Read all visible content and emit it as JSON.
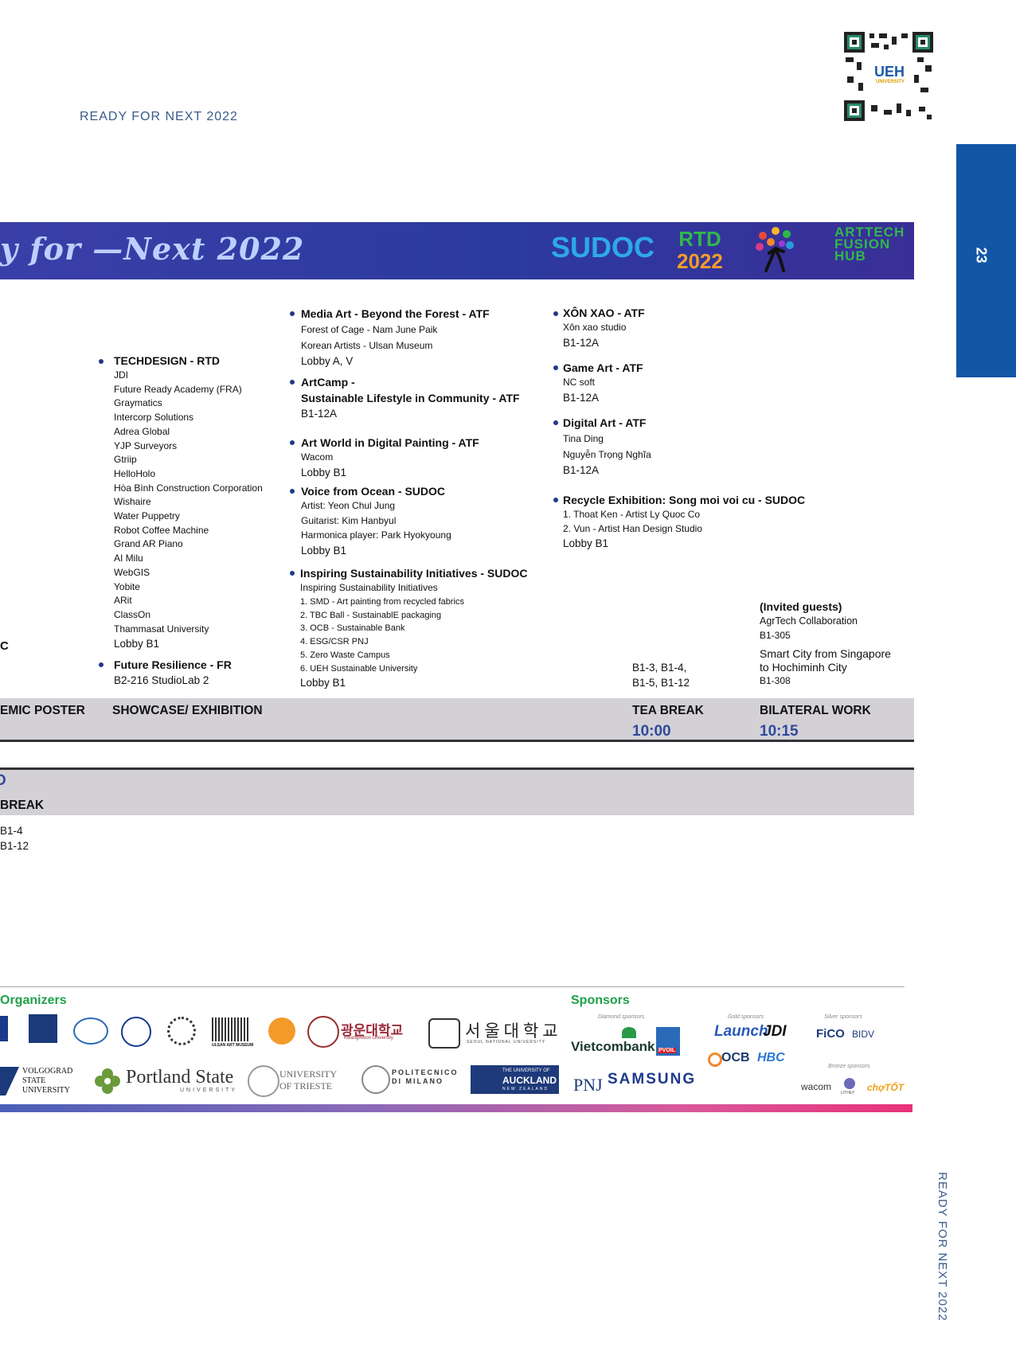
{
  "header": {
    "left_text": "READY FOR NEXT 2022"
  },
  "page": {
    "number": "23",
    "side_footer": "READY FOR NEXT 2022"
  },
  "qr": {
    "label": "UEH",
    "sublabel": "UNIVERSITY"
  },
  "banner": {
    "title": "y for —Next 2022",
    "logos": {
      "sudoc": "SUDOC",
      "rtd": "RTD",
      "rtd_year": "2022",
      "arttech": [
        "ARTTECH",
        "FUSION",
        "HUB"
      ]
    }
  },
  "col1": {
    "techdesign": {
      "title": "TECHDESIGN - RTD",
      "items": [
        "JDI",
        "Future Ready Academy (FRA)",
        "Graymatics",
        "Intercorp Solutions",
        "Adrea Global",
        "YJP Surveyors",
        "Gtriip",
        "HelloHolo",
        "Hòa Bình Construction Corporation",
        "Wishaire",
        "Water Puppetry",
        "Robot Coffee Machine",
        "Grand AR Piano",
        "AI Milu",
        "WebGIS",
        "Yobite",
        "ARit",
        "ClassOn",
        "Thammasat University"
      ],
      "location": "Lobby B1"
    },
    "future": {
      "title": "Future Resilience - FR",
      "location": "B2-216 StudioLab 2"
    }
  },
  "col2": {
    "media": {
      "title": "Media Art - Beyond the Forest - ATF",
      "items": [
        "Forest of Cage - Nam June Paik",
        "Korean Artists - Ulsan Museum"
      ],
      "location": "Lobby A, V"
    },
    "artcamp": {
      "title1": "ArtCamp -",
      "title2": "Sustainable Lifestyle in Community - ATF",
      "location": "B1-12A"
    },
    "artworld": {
      "title": "Art World in Digital Painting - ATF",
      "items": [
        "Wacom"
      ],
      "location": "Lobby B1"
    },
    "voice": {
      "title": "Voice from Ocean - SUDOC",
      "items": [
        "Artist: Yeon Chul Jung",
        "Guitarist: Kim Hanbyul",
        "Harmonica player: Park Hyokyoung"
      ],
      "location": "Lobby B1"
    },
    "inspiring": {
      "title": "Inspiring Sustainability Initiatives - SUDOC",
      "subtitle": "Inspiring Sustainability Initiatives",
      "items": [
        "1. SMD - Art painting from recycled fabrics",
        "2. TBC Ball - SustainablE packaging",
        "3. OCB - Sustainable Bank",
        "4. ESG/CSR PNJ",
        "5. Zero Waste Campus",
        "6. UEH Sustainable University"
      ],
      "location": "Lobby B1"
    }
  },
  "col3": {
    "xonxao": {
      "title": "XÔN XAO - ATF",
      "items": [
        "Xôn xao studio"
      ],
      "location": "B1-12A"
    },
    "game": {
      "title": "Game Art - ATF",
      "items": [
        "NC soft"
      ],
      "location": "B1-12A"
    },
    "digital": {
      "title": "Digital Art - ATF",
      "items": [
        "Tina Ding",
        "Nguyễn Trọng Nghĩa"
      ],
      "location": "B1-12A"
    },
    "recycle": {
      "title": "Recycle Exhibition: Song moi voi cu - SUDOC",
      "items": [
        "1. Thoat Ken - Artist Ly Quoc Co",
        "2. Vun - Artist Han Design Studio"
      ],
      "location": "Lobby B1"
    }
  },
  "col4": {
    "rooms1": "B1-3, B1-4,",
    "rooms2": "B1-5, B1-12"
  },
  "col5": {
    "invited": "(Invited guests)",
    "agr": "AgrTech Collaboration",
    "agr_room": "B1-305",
    "smart1": "Smart City from Singapore",
    "smart2": "to Hochiminh City",
    "smart_room": "B1-308"
  },
  "left_edge": {
    "c": "C",
    "d": "D",
    "break": "BREAK",
    "r1": "B1-4",
    "r2": "B1-12"
  },
  "table": {
    "headers": [
      "EMIC POSTER",
      "SHOWCASE/ EXHIBITION",
      "TEA BREAK",
      "BILATERAL WORK"
    ],
    "times": [
      "10:00",
      "10:15"
    ]
  },
  "organizers": {
    "label": "Organizers",
    "logos": [
      "ULSAN ART MUSEUM",
      "광운대학교",
      "KwangWoon University",
      "서울대학교",
      "SEOUL NATIONAL UNIVERSITY",
      "VOLGOGRAD",
      "STATE",
      "UNIVERSITY",
      "Portland State",
      "UNIVERSITY",
      "UNIVERSITY",
      "OF TRIESTE",
      "POLITECNICO",
      "DI MILANO",
      "THE UNIVERSITY OF",
      "AUCKLAND",
      "NEW ZEALAND"
    ]
  },
  "sponsors": {
    "label": "Sponsors",
    "tiers": [
      "Diamond sponsors",
      "Gold sponsors",
      "Silver sponsors",
      "Bronze sponsors"
    ],
    "logos": [
      "Vietcombank",
      "PVOIL",
      "PNJ",
      "SAMSUNG",
      "Launch",
      "JDI",
      "OCB",
      "HBC",
      "FiCO",
      "BIDV",
      "wacom",
      "LITHEY",
      "chợTỐT"
    ]
  },
  "colors": {
    "accent": "#1256a6",
    "banner": "#2c3a9e",
    "time": "#2f4a9a",
    "green": "#1fa14a"
  }
}
